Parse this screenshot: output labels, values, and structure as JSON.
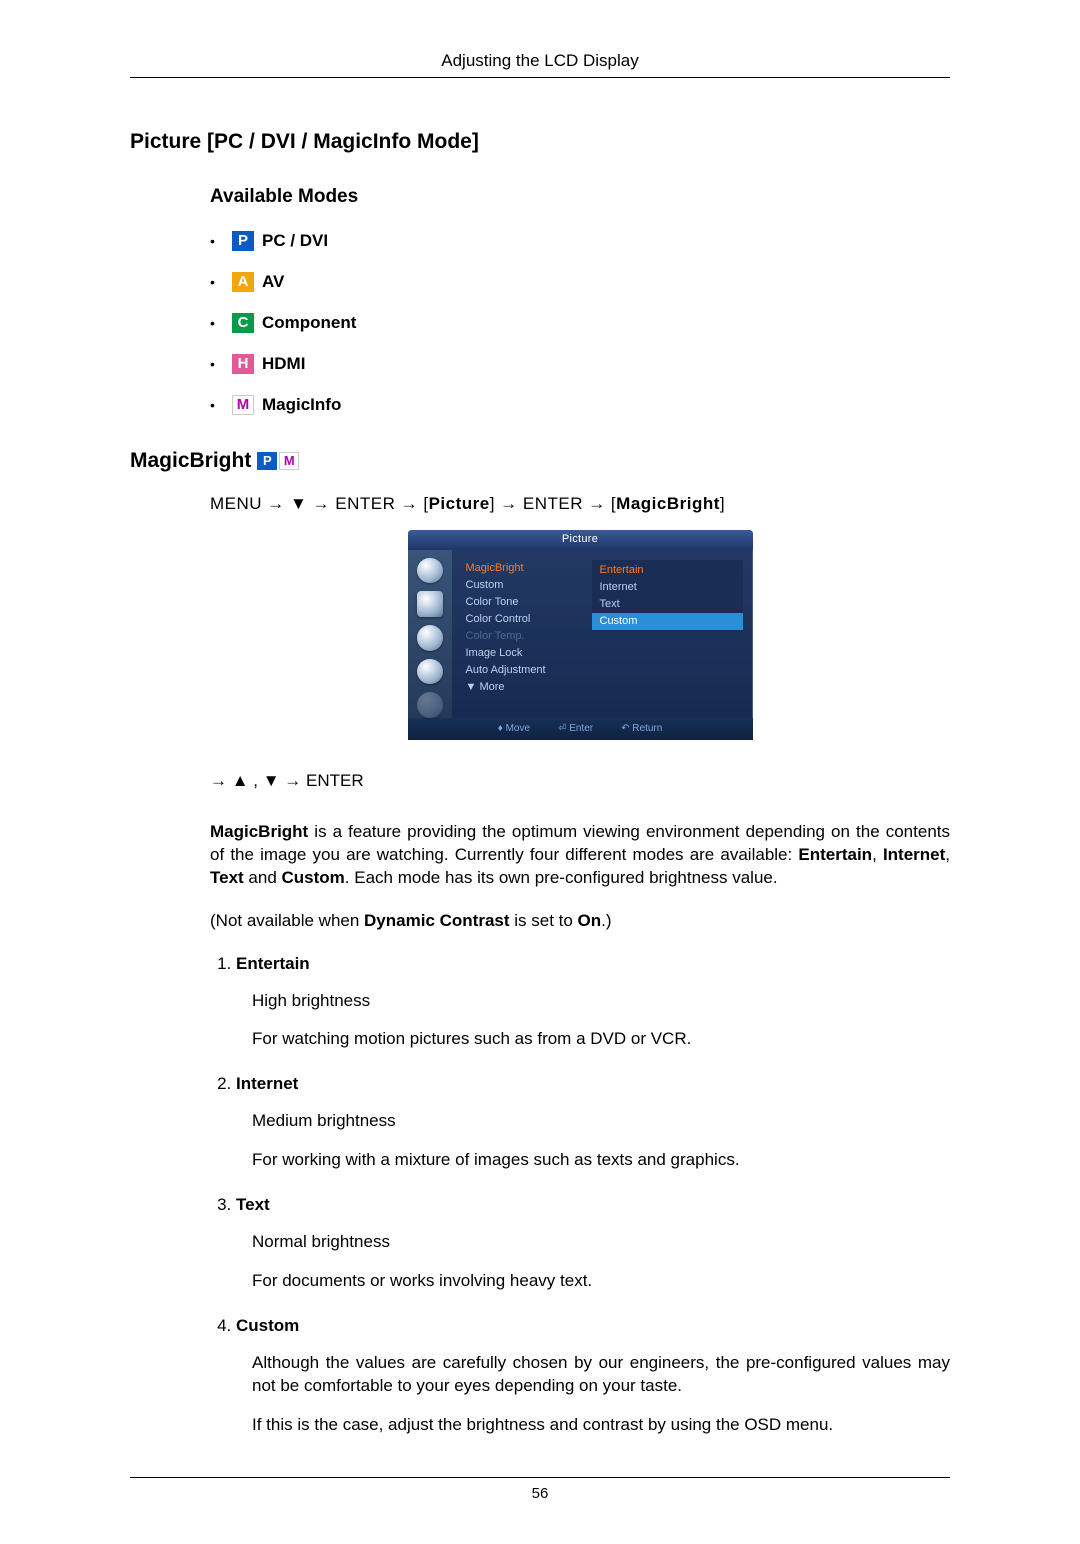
{
  "header": {
    "running_title": "Adjusting the LCD Display"
  },
  "section": {
    "title": "Picture [PC / DVI / MagicInfo Mode]"
  },
  "available_modes": {
    "heading": "Available Modes",
    "items": [
      {
        "badge": "P",
        "badge_class": "badge-p",
        "label": "PC / DVI"
      },
      {
        "badge": "A",
        "badge_class": "badge-a",
        "label": "AV"
      },
      {
        "badge": "C",
        "badge_class": "badge-c",
        "label": "Component"
      },
      {
        "badge": "H",
        "badge_class": "badge-h",
        "label": "HDMI"
      },
      {
        "badge": "M",
        "badge_class": "badge-m",
        "label": "MagicInfo"
      }
    ]
  },
  "feature": {
    "title": "MagicBright",
    "nav_path_prefix": "MENU → ▼ → ENTER → [",
    "nav_path_mid1": "Picture",
    "nav_path_mid2": "] → ENTER → [",
    "nav_path_mid3": "MagicBright",
    "nav_path_suffix": "]",
    "nav_seq": "→ ▲ , ▼ → ENTER",
    "desc_lead": "MagicBright",
    "desc_body": " is a feature providing the optimum viewing environment depending on the contents of the image you are watching. Currently four different modes are available: ",
    "desc_m1": "Entertain",
    "desc_s1": ", ",
    "desc_m2": "Internet",
    "desc_s2": ", ",
    "desc_m3": "Text",
    "desc_s3": " and ",
    "desc_m4": "Custom",
    "desc_tail": ". Each mode has its own pre-configured brightness value.",
    "note_pre": "(Not available when ",
    "note_b1": "Dynamic Contrast",
    "note_mid": " is set to ",
    "note_b2": "On",
    "note_post": ".)",
    "list": [
      {
        "title": "Entertain",
        "p1": "High brightness",
        "p2": "For watching motion pictures such as from a DVD or VCR."
      },
      {
        "title": "Internet",
        "p1": "Medium brightness",
        "p2": "For working with a mixture of images such as texts and graphics."
      },
      {
        "title": "Text",
        "p1": "Normal brightness",
        "p2": "For documents or works involving heavy text."
      },
      {
        "title": "Custom",
        "p1": "Although the values are carefully chosen by our engineers, the pre-configured values may not be comfortable to your eyes depending on your taste.",
        "p2": "If this is the case, adjust the brightness and contrast by using the OSD menu."
      }
    ]
  },
  "osd": {
    "title": "Picture",
    "left": [
      "MagicBright",
      "Custom",
      "Color Tone",
      "Color Control",
      "Color Temp.",
      "Image Lock",
      "Auto Adjustment",
      "▼ More"
    ],
    "options": [
      "Entertain",
      "Internet",
      "Text",
      "Custom"
    ],
    "footer": {
      "move": "Move",
      "enter": "Enter",
      "return": "Return"
    }
  },
  "footer": {
    "page_number": "56"
  }
}
